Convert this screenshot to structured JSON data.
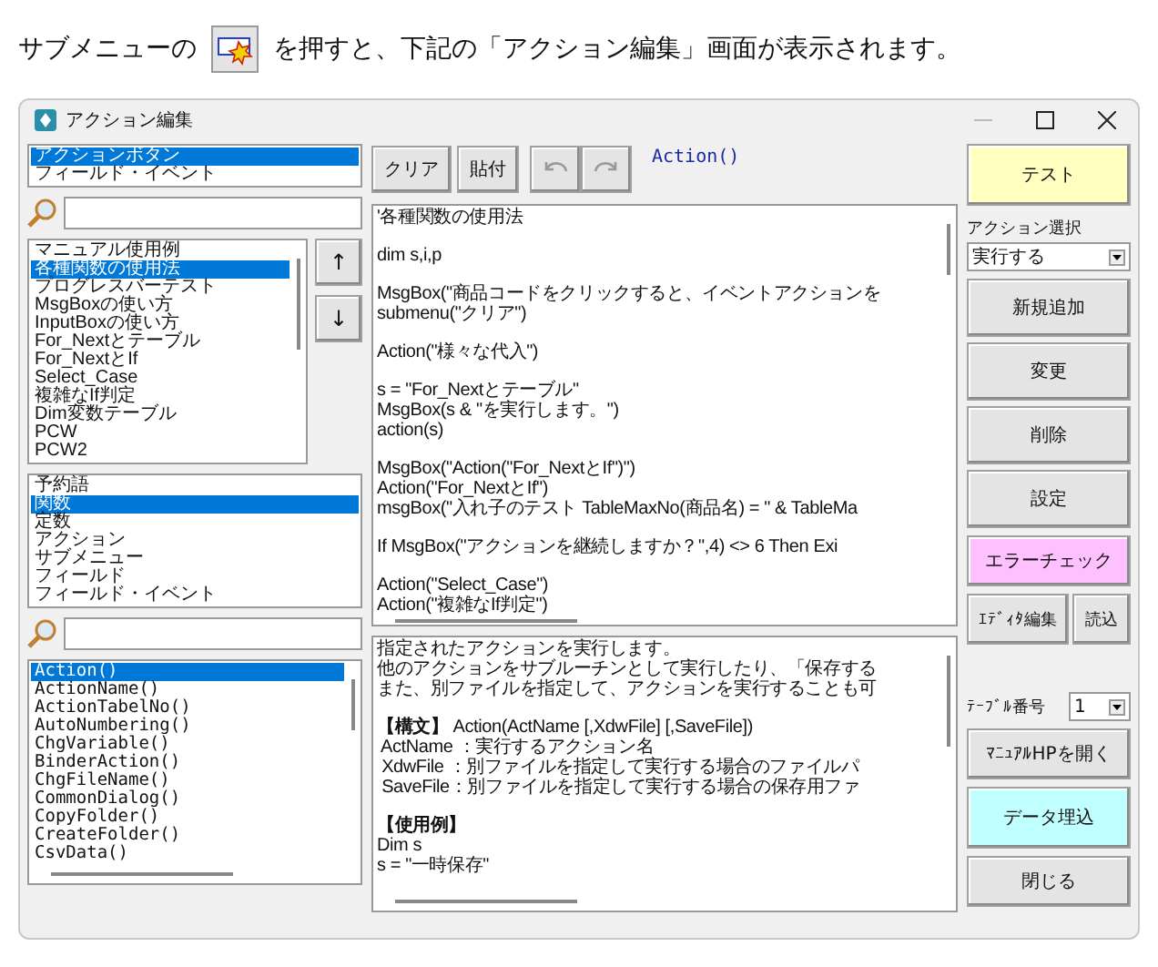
{
  "intro": {
    "before": "サブメニューの",
    "after": "を押すと、下記の「アクション編集」画面が表示されます。"
  },
  "window": {
    "title": "アクション編集"
  },
  "type_list": [
    {
      "label": "アクションボタン",
      "selected": true
    },
    {
      "label": "フィールド・イベント",
      "selected": false
    }
  ],
  "action_list": [
    {
      "label": "マニュアル使用例",
      "selected": false
    },
    {
      "label": "各種関数の使用法",
      "selected": true
    },
    {
      "label": "プログレスバーテスト",
      "selected": false
    },
    {
      "label": "MsgBoxの使い方",
      "selected": false
    },
    {
      "label": "InputBoxの使い方",
      "selected": false
    },
    {
      "label": "For_Nextとテーブル",
      "selected": false
    },
    {
      "label": "For_NextとIf",
      "selected": false
    },
    {
      "label": "Select_Case",
      "selected": false
    },
    {
      "label": "複雑なIf判定",
      "selected": false
    },
    {
      "label": "Dim変数テーブル",
      "selected": false
    },
    {
      "label": "PCW",
      "selected": false
    },
    {
      "label": "PCW2",
      "selected": false
    }
  ],
  "move_buttons": [
    "↑",
    "↓"
  ],
  "category_list": [
    {
      "label": "予約語",
      "selected": false
    },
    {
      "label": "関数",
      "selected": true
    },
    {
      "label": "定数",
      "selected": false
    },
    {
      "label": "アクション",
      "selected": false
    },
    {
      "label": "サブメニュー",
      "selected": false
    },
    {
      "label": "フィールド",
      "selected": false
    },
    {
      "label": "フィールド・イベント",
      "selected": false
    }
  ],
  "function_list": [
    {
      "label": "Action()",
      "selected": true
    },
    {
      "label": "ActionName()",
      "selected": false
    },
    {
      "label": "ActionTabelNo()",
      "selected": false
    },
    {
      "label": "AutoNumbering()",
      "selected": false
    },
    {
      "label": "ChgVariable()",
      "selected": false
    },
    {
      "label": "BinderAction()",
      "selected": false
    },
    {
      "label": "ChgFileName()",
      "selected": false
    },
    {
      "label": "CommonDialog()",
      "selected": false
    },
    {
      "label": "CopyFolder()",
      "selected": false
    },
    {
      "label": "CreateFolder()",
      "selected": false
    },
    {
      "label": "CsvData()",
      "selected": false
    }
  ],
  "toolbar": {
    "buttons": [
      "クリア",
      "貼付"
    ],
    "current": "Action()"
  },
  "code": [
    [
      "'各種関数の使用法"
    ],
    [
      "dim s,i,p"
    ],
    [
      "MsgBox(\"商品コードをクリックすると、イベントアクションを",
      "submenu(\"クリア\")"
    ],
    [
      "Action(\"様々な代入\")"
    ],
    [
      "s = \"For_Nextとテーブル\"",
      "MsgBox(s & \"を実行します。\")",
      "action(s)"
    ],
    [
      "MsgBox(\"Action(\"For_NextとIf\")\")",
      "Action(\"For_NextとIf\")",
      "msgBox(\"入れ子のテスト TableMaxNo(商品名) = \" & TableMa"
    ],
    [
      "If MsgBox(\"アクションを継続しますか？\",4) <> 6 Then Exi"
    ],
    [
      "Action(\"Select_Case\")",
      "Action(\"複雑なIf判定\")"
    ]
  ],
  "description": [
    [
      "指定されたアクションを実行します。",
      "他のアクションをサブルーチンとして実行したり、「保存する",
      "また、別ファイルを指定して、アクションを実行することも可"
    ],
    [
      "**【構文】** Action(ActName [,XdwFile] [,SaveFile])",
      " ActName ：実行するアクション名",
      " XdwFile ：別ファイルを指定して実行する場合のファイルパ",
      " SaveFile：別ファイルを指定して実行する場合の保存用ファ"
    ],
    [
      "**【使用例】**",
      "Dim s",
      "s = \"一時保存\""
    ]
  ],
  "right": {
    "test_button": "テスト",
    "action_select": {
      "label": "アクション選択",
      "value": "実行する"
    },
    "buttons": [
      "新規追加",
      "変更",
      "削除",
      "設定"
    ],
    "error_check_button": "エラーチェック",
    "editor_buttons": [
      "ｴﾃﾞｨﾀ編集",
      "読込"
    ],
    "table_select": {
      "label": "ﾃｰﾌﾞﾙ番号",
      "value": "1"
    },
    "manual_button": "ﾏﾆｭｱﾙHPを開く",
    "embed_button": "データ埋込",
    "close_button": "閉じる"
  }
}
